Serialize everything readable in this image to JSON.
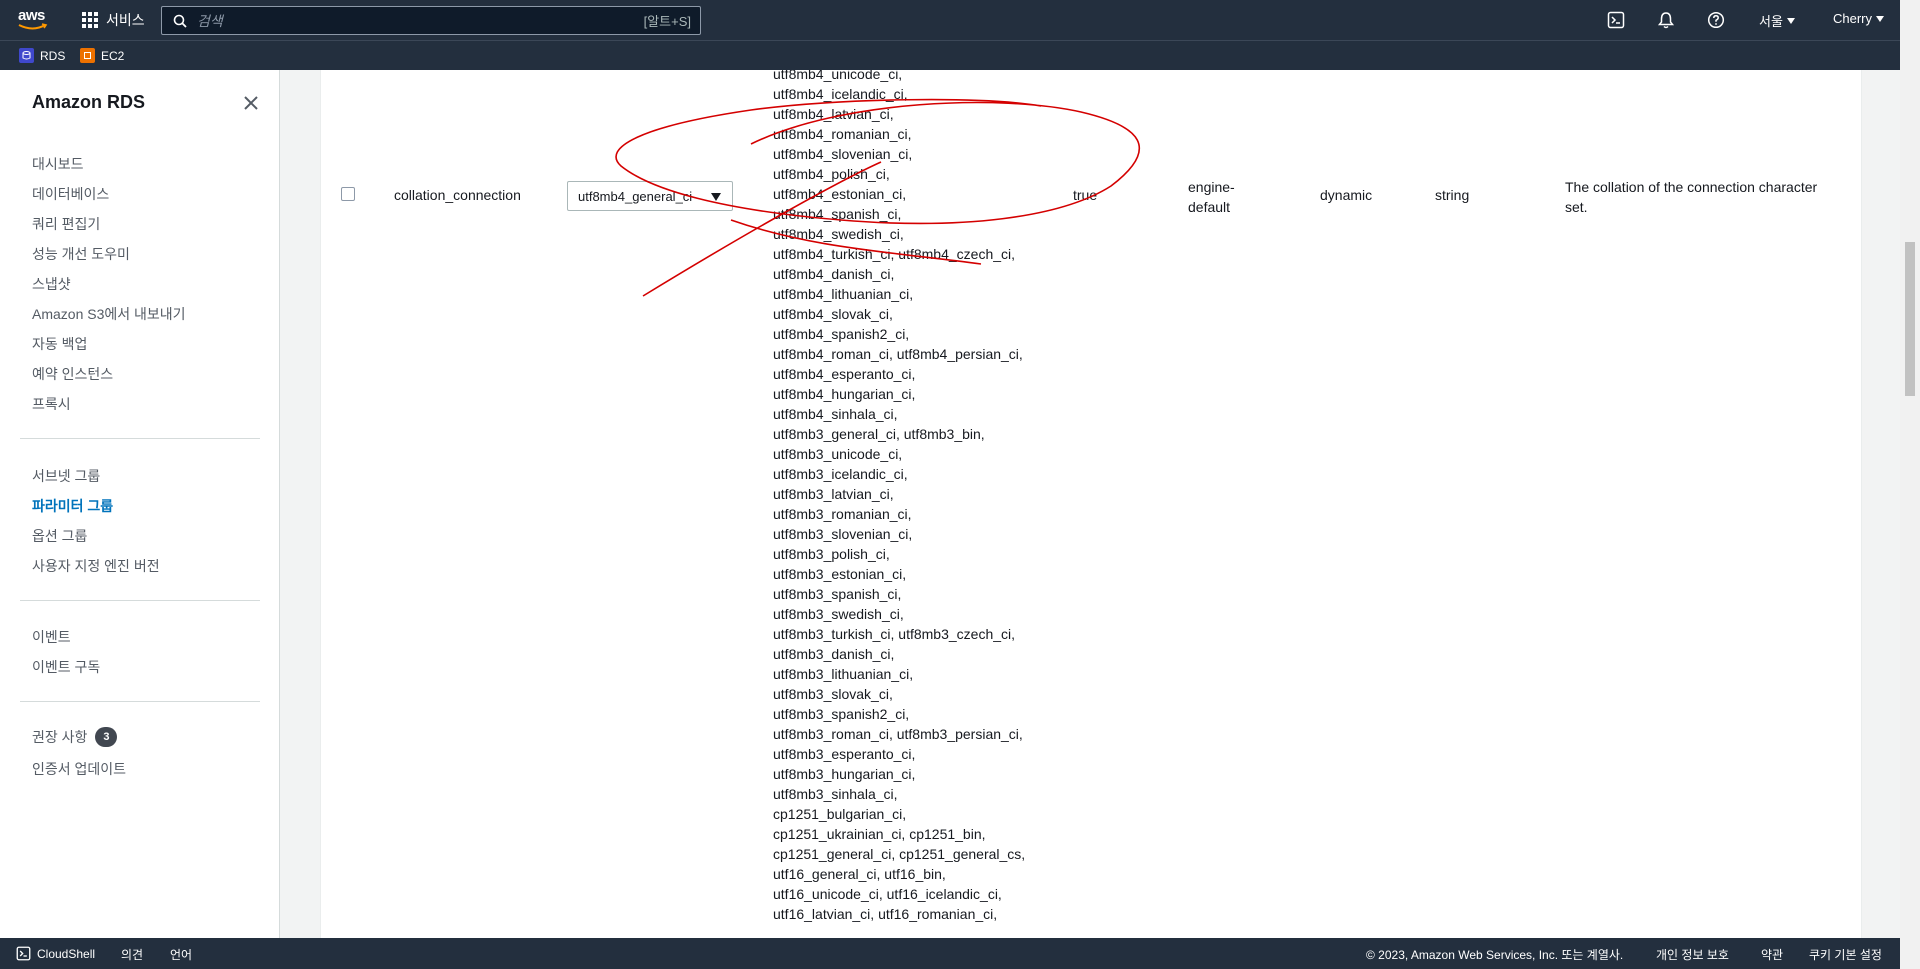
{
  "topnav": {
    "logo_text": "aws",
    "services_label": "서비스",
    "search_placeholder": "검색",
    "search_shortcut": "[알트+S]",
    "region_label": "서울",
    "user_label": "Cherry"
  },
  "favorites": [
    {
      "label": "RDS",
      "color": "#3f48cc"
    },
    {
      "label": "EC2",
      "color": "#ed7100"
    }
  ],
  "sidebar": {
    "title": "Amazon RDS",
    "group1": [
      "대시보드",
      "데이터베이스",
      "쿼리 편집기",
      "성능 개선 도우미",
      "스냅샷",
      "Amazon S3에서 내보내기",
      "자동 백업",
      "예약 인스턴스",
      "프록시"
    ],
    "group2": [
      "서브넷 그룹",
      "파라미터 그룹",
      "옵션 그룹",
      "사용자 지정 엔진 버전"
    ],
    "active_item": "파라미터 그룹",
    "group3": [
      "이벤트",
      "이벤트 구독"
    ],
    "group4": [
      {
        "label": "권장 사항",
        "badge": "3"
      },
      {
        "label": "인증서 업데이트"
      }
    ]
  },
  "parameter_row": {
    "name": "collation_connection",
    "value": "utf8mb4_general_ci",
    "modifiable": "true",
    "source_line1": "engine-",
    "source_line2": "default",
    "apply_type": "dynamic",
    "data_type": "string",
    "description_line1": "The collation of the connection character",
    "description_line2": "set.",
    "allowed_values": [
      "utf8mb4_unicode_ci,",
      "utf8mb4_icelandic_ci,",
      "utf8mb4_latvian_ci,",
      "utf8mb4_romanian_ci,",
      "utf8mb4_slovenian_ci,",
      "utf8mb4_polish_ci,",
      "utf8mb4_estonian_ci,",
      "utf8mb4_spanish_ci,",
      "utf8mb4_swedish_ci,",
      "utf8mb4_turkish_ci, utf8mb4_czech_ci,",
      "utf8mb4_danish_ci,",
      "utf8mb4_lithuanian_ci,",
      "utf8mb4_slovak_ci,",
      "utf8mb4_spanish2_ci,",
      "utf8mb4_roman_ci, utf8mb4_persian_ci,",
      "utf8mb4_esperanto_ci,",
      "utf8mb4_hungarian_ci,",
      "utf8mb4_sinhala_ci,",
      "utf8mb3_general_ci, utf8mb3_bin,",
      "utf8mb3_unicode_ci,",
      "utf8mb3_icelandic_ci,",
      "utf8mb3_latvian_ci,",
      "utf8mb3_romanian_ci,",
      "utf8mb3_slovenian_ci,",
      "utf8mb3_polish_ci,",
      "utf8mb3_estonian_ci,",
      "utf8mb3_spanish_ci,",
      "utf8mb3_swedish_ci,",
      "utf8mb3_turkish_ci, utf8mb3_czech_ci,",
      "utf8mb3_danish_ci,",
      "utf8mb3_lithuanian_ci,",
      "utf8mb3_slovak_ci,",
      "utf8mb3_spanish2_ci,",
      "utf8mb3_roman_ci, utf8mb3_persian_ci,",
      "utf8mb3_esperanto_ci,",
      "utf8mb3_hungarian_ci,",
      "utf8mb3_sinhala_ci,",
      "cp1251_bulgarian_ci,",
      "cp1251_ukrainian_ci, cp1251_bin,",
      "cp1251_general_ci, cp1251_general_cs,",
      "utf16_general_ci, utf16_bin,",
      "utf16_unicode_ci, utf16_icelandic_ci,",
      "utf16_latvian_ci, utf16_romanian_ci,"
    ]
  },
  "footer": {
    "cloudshell_label": "CloudShell",
    "feedback_label": "의견",
    "language_label": "언어",
    "copyright": "© 2023, Amazon Web Services, Inc. 또는 계열사.",
    "privacy_label": "개인 정보 보호",
    "terms_label": "약관",
    "cookie_label": "쿠키 기본 설정"
  },
  "colors": {
    "nav_bg": "#232f3e",
    "active_link": "#0073bb",
    "annotation_stroke": "#d40000"
  }
}
